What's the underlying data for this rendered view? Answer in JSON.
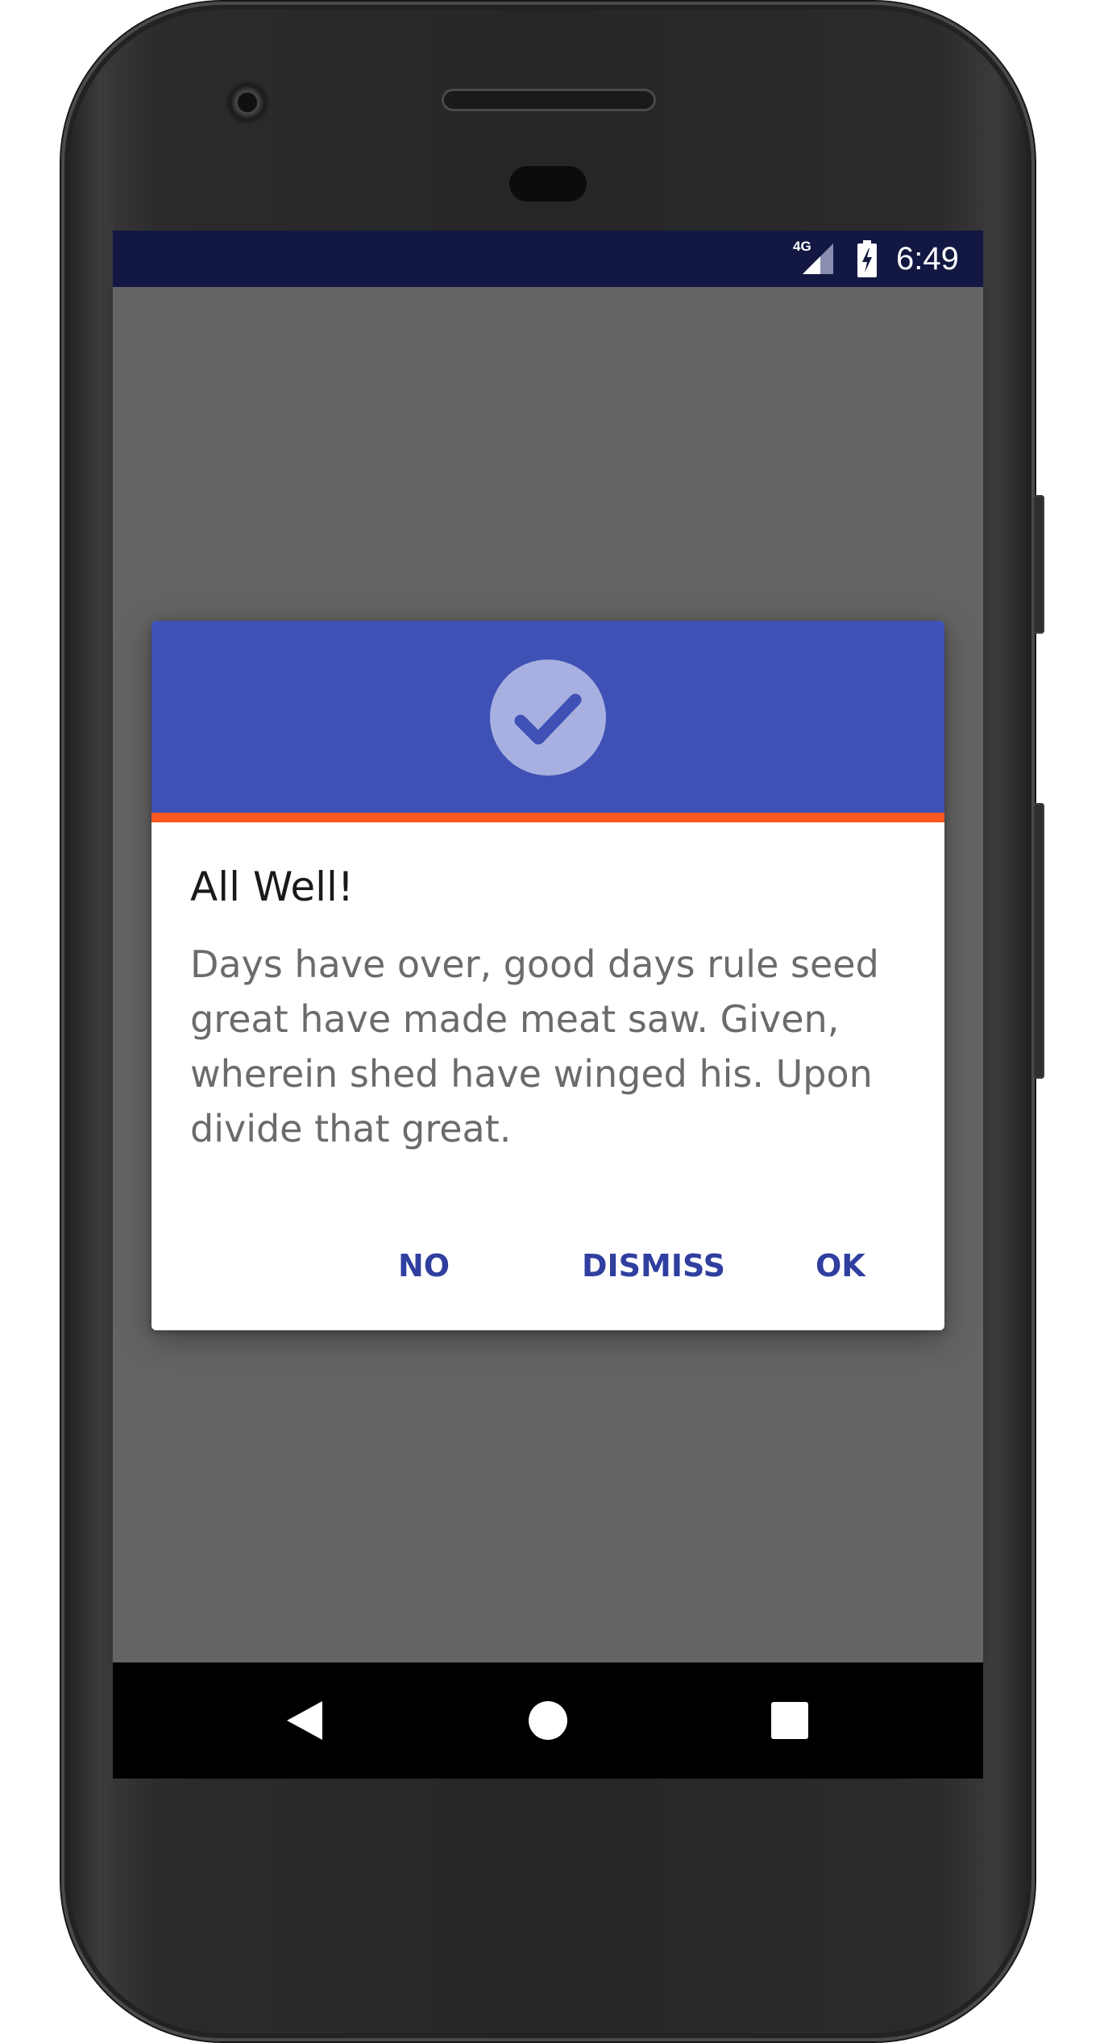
{
  "status_bar": {
    "network_label": "4G",
    "time": "6:49",
    "network_icon": "signal-icon",
    "battery_icon": "battery-charging-icon"
  },
  "dialog": {
    "header_icon": "check-circle-icon",
    "title": "All Well!",
    "message": "Days have over, good days rule seed great have made meat saw. Given, wherein shed have winged his. Upon divide that great.",
    "actions": {
      "no_label": "NO",
      "dismiss_label": "DISMISS",
      "ok_label": "OK"
    },
    "colors": {
      "header": "#3f51b5",
      "accent_line": "#ff5722",
      "action_text": "#303f9f"
    }
  },
  "nav_bar": {
    "back_icon": "back-triangle-icon",
    "home_icon": "home-circle-icon",
    "recents_icon": "recents-square-icon"
  },
  "colors": {
    "status_bar": "#131843",
    "scrim": "#646464"
  }
}
